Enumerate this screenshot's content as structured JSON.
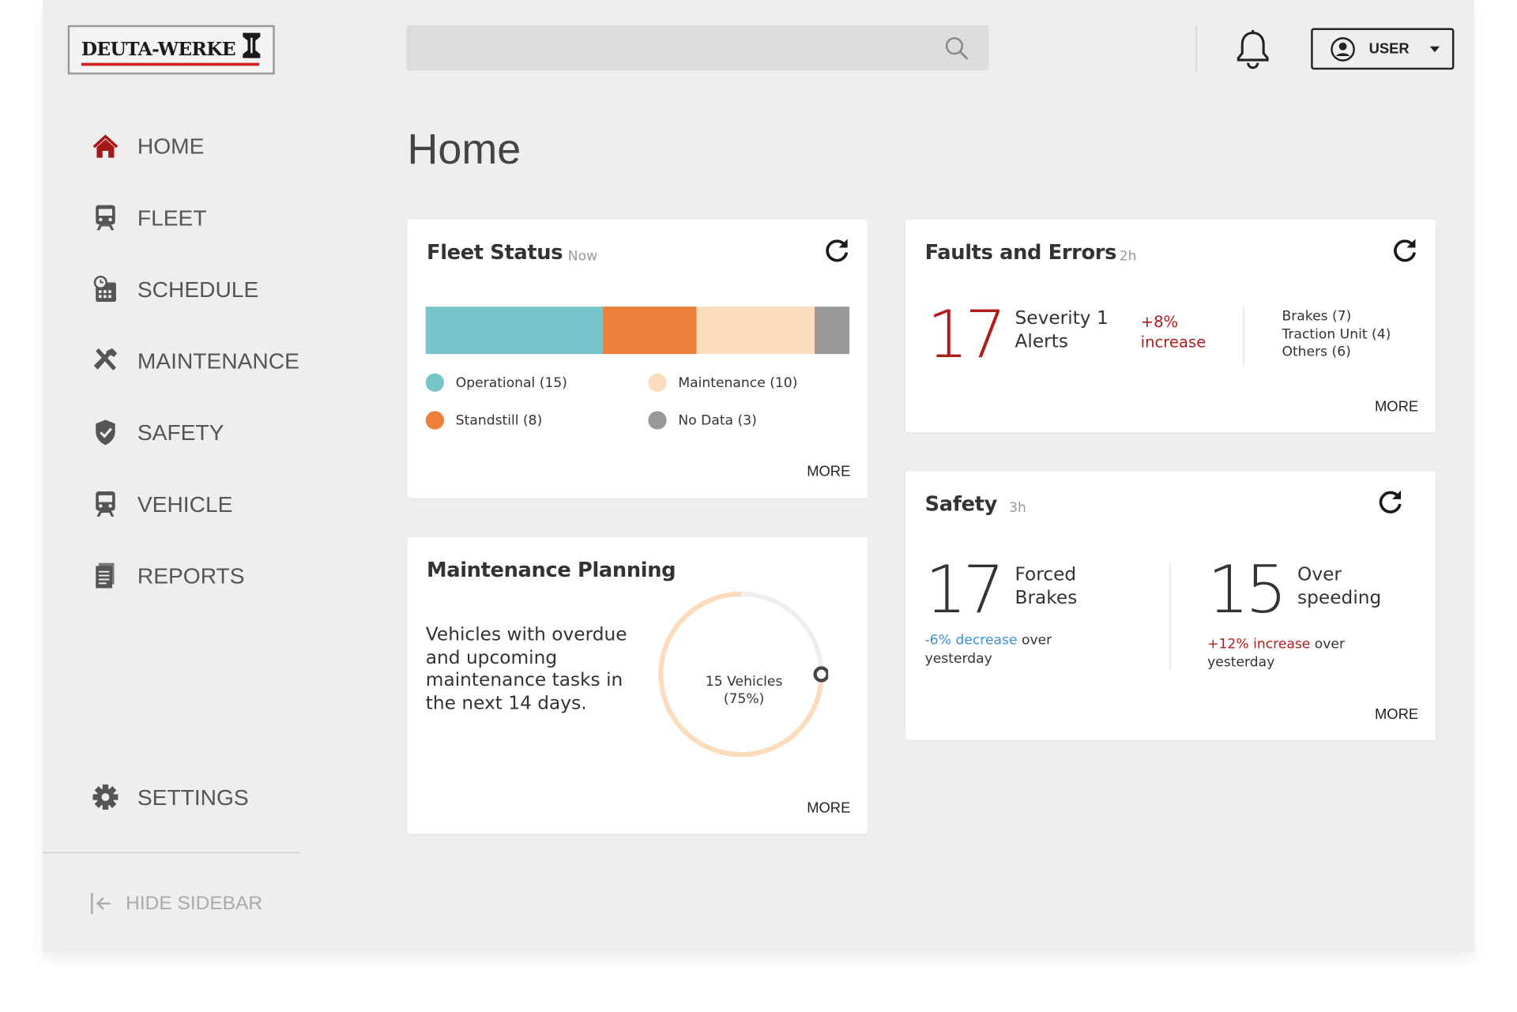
{
  "brand": {
    "logo_text": "DEUTA-WERKE",
    "accent": "#d42020"
  },
  "header": {
    "search_placeholder": "",
    "user_label": "USER",
    "icons": [
      "search-icon",
      "bell-icon",
      "user-circle-icon",
      "caret-down-icon"
    ]
  },
  "sidebar": {
    "items": [
      {
        "label": "HOME",
        "icon": "home-icon",
        "active": true
      },
      {
        "label": "FLEET",
        "icon": "train-icon"
      },
      {
        "label": "SCHEDULE",
        "icon": "calendar-clock-icon"
      },
      {
        "label": "MAINTENANCE",
        "icon": "tools-icon"
      },
      {
        "label": "SAFETY",
        "icon": "shield-check-icon"
      },
      {
        "label": "VEHICLE",
        "icon": "train-icon"
      },
      {
        "label": "REPORTS",
        "icon": "document-icon"
      }
    ],
    "settings": "SETTINGS",
    "hide": "HIDE SIDEBAR"
  },
  "page_title": "Home",
  "fleet_status": {
    "title": "Fleet Status",
    "time": "Now",
    "more": "MORE",
    "segments": [
      {
        "label": "Operational (15)",
        "value": 15,
        "color": "#76c5c8"
      },
      {
        "label": "Standstill (8)",
        "value": 8,
        "color": "#ee7f3b"
      },
      {
        "label": "Maintenance (10)",
        "value": 10,
        "color": "#fcdcbc"
      },
      {
        "label": "No Data (3)",
        "value": 3,
        "color": "#999999"
      }
    ]
  },
  "maintenance": {
    "title": "Maintenance Planning",
    "text": "Vehicles with overdue and upcoming maintenance tasks in the next 14 days.",
    "ring_line1": "15 Vehicles",
    "ring_line2": "(75%)",
    "progress": 0.75,
    "more": "MORE"
  },
  "faults": {
    "title": "Faults and Errors",
    "time": "2h",
    "count": "17",
    "label1": "Severity 1",
    "label2": "Alerts",
    "pct": "+8%",
    "pct_word": "increase",
    "breakdown": [
      "Brakes (7)",
      "Traction Unit (4)",
      "Others (6)"
    ],
    "more": "MORE"
  },
  "safety": {
    "title": "Safety",
    "time": "3h",
    "left": {
      "count": "17",
      "label1": "Forced",
      "label2": "Brakes",
      "trend": "-6% decrease",
      "trend_rest": " over",
      "trend_line2": "yesterday",
      "trend_color": "#3b8fd9"
    },
    "right": {
      "count": "15",
      "label1": "Over",
      "label2": "speeding",
      "trend": "+12% increase",
      "trend_rest": " over",
      "trend_line2": "yesterday",
      "trend_color": "#b01c1c"
    },
    "more": "MORE"
  }
}
